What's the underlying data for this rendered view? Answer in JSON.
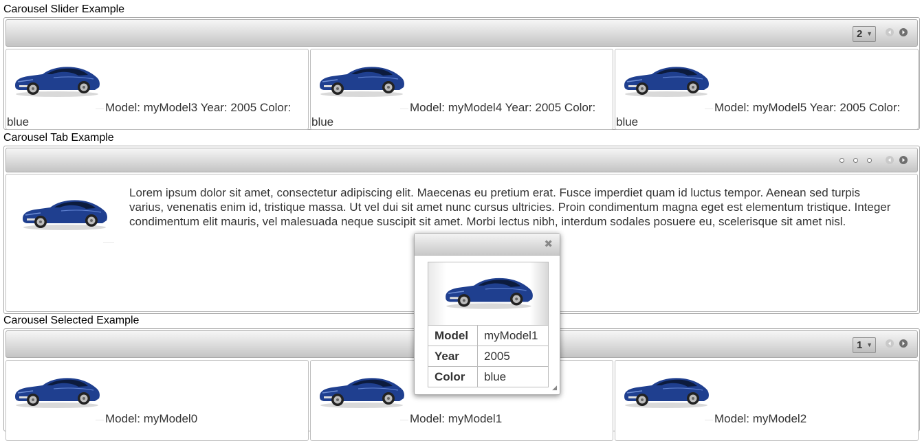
{
  "sections": {
    "slider": {
      "title": "Carousel Slider Example",
      "page_select": "2",
      "items": [
        {
          "text": "Model: myModel3 Year: 2005 Color: blue"
        },
        {
          "text": "Model: myModel4 Year: 2005 Color: blue"
        },
        {
          "text": "Model: myModel5 Year: 2005 Color: blue"
        }
      ]
    },
    "tab": {
      "title": "Carousel Tab Example",
      "content": "Lorem ipsum dolor sit amet, consectetur adipiscing elit. Maecenas eu pretium erat. Fusce imperdiet quam id luctus tempor. Aenean sed turpis varius, venenatis enim id, tristique massa. Ut vel dui sit amet nunc cursus ultricies. Proin condimentum magna eget est elementum tristique. Integer condimentum elit mauris, vel malesuada neque suscipit sit amet. Morbi lectus nibh, interdum sodales posuere eu, scelerisque sit amet nisl."
    },
    "selected": {
      "title": "Carousel Selected Example",
      "page_select": "1",
      "items": [
        {
          "text": "Model: myModel0"
        },
        {
          "text": "Model: myModel1"
        },
        {
          "text": "Model: myModel2"
        }
      ]
    }
  },
  "dialog": {
    "close_icon": "close-icon",
    "rows": [
      {
        "key": "Model",
        "value": "myModel1"
      },
      {
        "key": "Year",
        "value": "2005"
      },
      {
        "key": "Color",
        "value": "blue"
      }
    ]
  },
  "colors": {
    "car_body": "#1f3f8f",
    "header_gradient_top": "#f6f6f6",
    "header_gradient_bottom": "#c4c4c4"
  }
}
